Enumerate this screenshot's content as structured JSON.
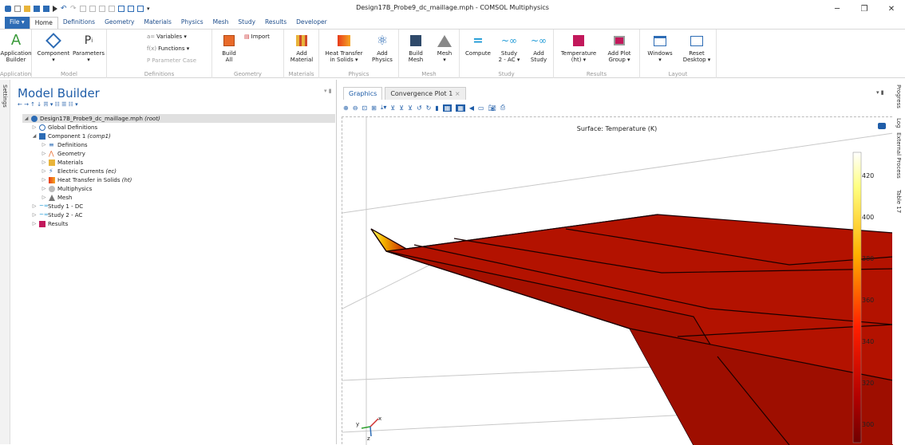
{
  "window": {
    "title": "Design17B_Probe9_dc_maillage.mph - COMSOL Multiphysics",
    "min": "─",
    "max": "❐",
    "close": "✕"
  },
  "menu_tabs": [
    {
      "label": "File ▾"
    },
    {
      "label": "Home"
    },
    {
      "label": "Definitions"
    },
    {
      "label": "Geometry"
    },
    {
      "label": "Materials"
    },
    {
      "label": "Physics"
    },
    {
      "label": "Mesh"
    },
    {
      "label": "Study"
    },
    {
      "label": "Results"
    },
    {
      "label": "Developer"
    }
  ],
  "ribbon": {
    "app_builder": "Application\nBuilder",
    "component": "Component\n▾",
    "parameters": "Parameters\n▾",
    "variables": "Variables ▾",
    "functions": "Functions ▾",
    "param_case": "Parameter Case",
    "build_all": "Build\nAll",
    "import": "Import",
    "add_material": "Add\nMaterial",
    "heat_transfer": "Heat Transfer\nin Solids ▾",
    "add_physics": "Add\nPhysics",
    "build_mesh": "Build\nMesh",
    "mesh": "Mesh\n▾",
    "compute": "Compute",
    "study2": "Study\n2 - AC ▾",
    "add_study": "Add\nStudy",
    "temperature": "Temperature\n(ht) ▾",
    "add_plot": "Add Plot\nGroup ▾",
    "windows": "Windows\n▾",
    "reset_desktop": "Reset\nDesktop ▾",
    "groups": {
      "application": "Application",
      "model": "Model",
      "definitions": "Definitions",
      "geometry": "Geometry",
      "materials": "Materials",
      "physics": "Physics",
      "mesh": "Mesh",
      "study": "Study",
      "results": "Results",
      "layout": "Layout"
    }
  },
  "side_left": "Settings",
  "model_builder": {
    "title": "Model Builder",
    "tools": "← → ↑ ↓ ☴ ▾ ☷ ☰ ☷ ▾",
    "tree": [
      {
        "label": "Design17B_Probe9_dc_maillage.mph",
        "tag": "(root)"
      },
      {
        "label": "Global Definitions",
        "tag": ""
      },
      {
        "label": "Component 1",
        "tag": "(comp1)"
      },
      {
        "label": "Definitions",
        "tag": ""
      },
      {
        "label": "Geometry",
        "tag": ""
      },
      {
        "label": "Materials",
        "tag": ""
      },
      {
        "label": "Electric Currents",
        "tag": "(ec)"
      },
      {
        "label": "Heat Transfer in Solids",
        "tag": "(ht)"
      },
      {
        "label": "Multiphysics",
        "tag": ""
      },
      {
        "label": "Mesh",
        "tag": ""
      },
      {
        "label": "Study 1 - DC",
        "tag": ""
      },
      {
        "label": "Study 2 - AC",
        "tag": ""
      },
      {
        "label": "Results",
        "tag": ""
      }
    ]
  },
  "graphics": {
    "tabs": [
      {
        "label": "Graphics"
      },
      {
        "label": "Convergence Plot 1"
      }
    ],
    "tab_close": "×",
    "surface_title": "Surface: Temperature (K)",
    "colorbar_ticks": [
      "420",
      "400",
      "380",
      "360",
      "340",
      "320",
      "300"
    ],
    "colorbar_range": [
      292,
      432
    ],
    "axis_y": "y",
    "axis_x": "x",
    "axis_z": "z"
  },
  "side_right": [
    "Progress",
    "Log",
    "External Process",
    "Table 17"
  ],
  "colors": {
    "accent": "#1f5da8",
    "surface": "#b31200",
    "hot": "#ffff66"
  }
}
